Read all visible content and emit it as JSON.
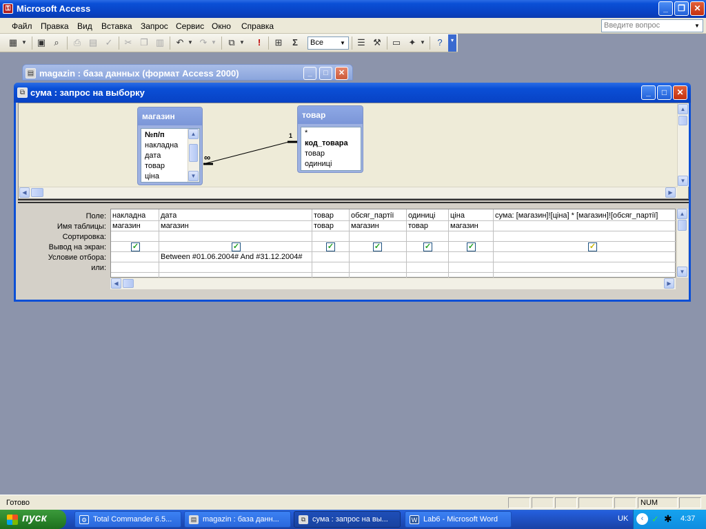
{
  "app": {
    "title": "Microsoft Access"
  },
  "menu": {
    "items": [
      "Файл",
      "Правка",
      "Вид",
      "Вставка",
      "Запрос",
      "Сервис",
      "Окно",
      "Справка"
    ],
    "help_placeholder": "Введите вопрос"
  },
  "toolbar": {
    "top_values": "Все"
  },
  "db_window": {
    "title": "magazin : база данных (формат Access 2000)"
  },
  "query_window": {
    "title": "сума : запрос на выборку",
    "tables": [
      {
        "name": "магазин",
        "fields": [
          "№п/п",
          "накладна",
          "дата",
          "товар",
          "ціна"
        ]
      },
      {
        "name": "товар",
        "fields": [
          "*",
          "код_товара",
          "товар",
          "одиниці"
        ]
      }
    ],
    "join": {
      "left_label": "∞",
      "right_label": "1"
    },
    "row_labels": [
      "Поле:",
      "Имя таблицы:",
      "Сортировка:",
      "Вывод на экран:",
      "Условие отбора:",
      "или:"
    ],
    "columns": [
      {
        "field": "накладна",
        "table": "магазин",
        "show": true,
        "criteria": ""
      },
      {
        "field": "дата",
        "table": "магазин",
        "show": true,
        "criteria": "Between #01.06.2004# And #31.12.2004#"
      },
      {
        "field": "товар",
        "table": "товар",
        "show": true,
        "criteria": ""
      },
      {
        "field": "обсяг_партії",
        "table": "магазин",
        "show": true,
        "criteria": ""
      },
      {
        "field": "одиниці",
        "table": "товар",
        "show": true,
        "criteria": ""
      },
      {
        "field": "ціна",
        "table": "магазин",
        "show": true,
        "criteria": ""
      },
      {
        "field": "сума: [магазин]![ціна] * [магазин]![обсяг_партії]",
        "table": "",
        "show": true,
        "criteria": ""
      }
    ]
  },
  "status": {
    "text": "Готово",
    "num": "NUM"
  },
  "taskbar": {
    "start": "пуск",
    "tasks": [
      "Total Commander 6.5...",
      "magazin : база данн...",
      "сума : запрос на вы...",
      "Lab6 - Microsoft Word"
    ],
    "lang": "UK",
    "clock": "4:37"
  },
  "colors": {
    "title_blue": "#0a4fd6",
    "desktop": "#8c94ab",
    "check_green": "#21a121"
  }
}
